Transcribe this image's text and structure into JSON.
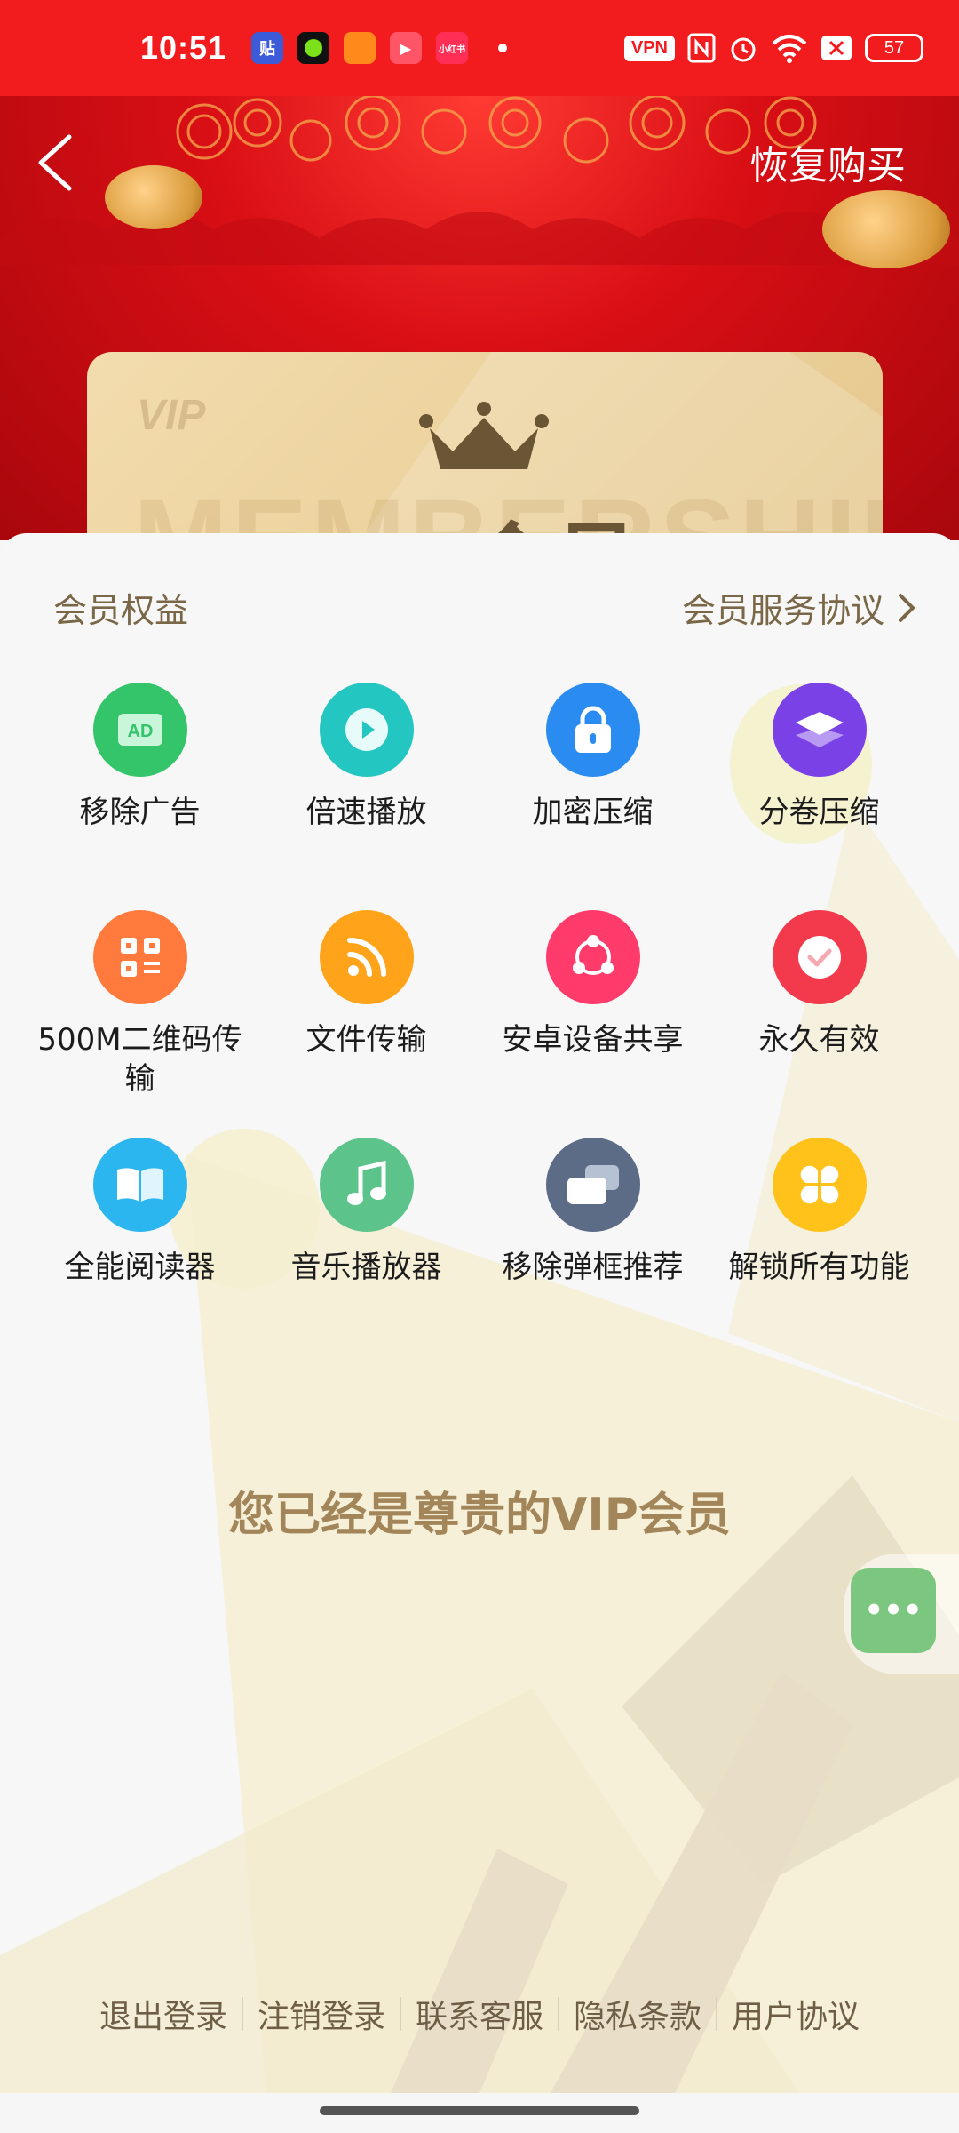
{
  "status_bar": {
    "time": "10:51",
    "apps": [
      {
        "icon": "tieba-app-icon",
        "text": "贴",
        "color": "#3d5bd8"
      },
      {
        "icon": "green-dot-app-icon",
        "text": "",
        "color": "#111111"
      },
      {
        "icon": "orange-app-icon",
        "text": "",
        "color": "#ff8a1c"
      },
      {
        "icon": "video-app-icon",
        "text": "▶",
        "color": "#ff5566"
      },
      {
        "icon": "xiaohongshu-app-icon",
        "text": "小红书",
        "color": "#ff2e55"
      }
    ],
    "vpn": "VPN",
    "battery": "57"
  },
  "header": {
    "restore_label": "恢复购买"
  },
  "vip_card": {
    "small_text": "VIP",
    "bg_word": "MEMBERSHIP",
    "title": "VIP会员"
  },
  "benefits": {
    "title": "会员权益",
    "agreement_label": "会员服务协议",
    "items": [
      {
        "label": "移除广告",
        "icon": "ad-block-icon",
        "color": "#34c46a"
      },
      {
        "label": "倍速播放",
        "icon": "play-speed-icon",
        "color": "#23c6c0"
      },
      {
        "label": "加密压缩",
        "icon": "lock-icon",
        "color": "#2a8cf0"
      },
      {
        "label": "分卷压缩",
        "icon": "layers-icon",
        "color": "#7a42e6"
      },
      {
        "label": "500M二维码传输",
        "icon": "qr-code-icon",
        "color": "#ff7a3c"
      },
      {
        "label": "文件传输",
        "icon": "file-transfer-icon",
        "color": "#ffa31a"
      },
      {
        "label": "安卓设备共享",
        "icon": "share-icon",
        "color": "#ff3b6b"
      },
      {
        "label": "永久有效",
        "icon": "check-badge-icon",
        "color": "#f23a4c"
      },
      {
        "label": "全能阅读器",
        "icon": "book-icon",
        "color": "#2bb6f0"
      },
      {
        "label": "音乐播放器",
        "icon": "music-icon",
        "color": "#5cc38a"
      },
      {
        "label": "移除弹框推荐",
        "icon": "popup-block-icon",
        "color": "#5c6b86"
      },
      {
        "label": "解锁所有功能",
        "icon": "unlock-all-icon",
        "color": "#ffc21a"
      }
    ]
  },
  "member_status": "您已经是尊贵的VIP会员",
  "chat_fab": {
    "icon": "more-dots-icon",
    "text": "•••"
  },
  "footer": {
    "links": [
      "退出登录",
      "注销登录",
      "联系客服",
      "隐私条款",
      "用户协议"
    ]
  }
}
